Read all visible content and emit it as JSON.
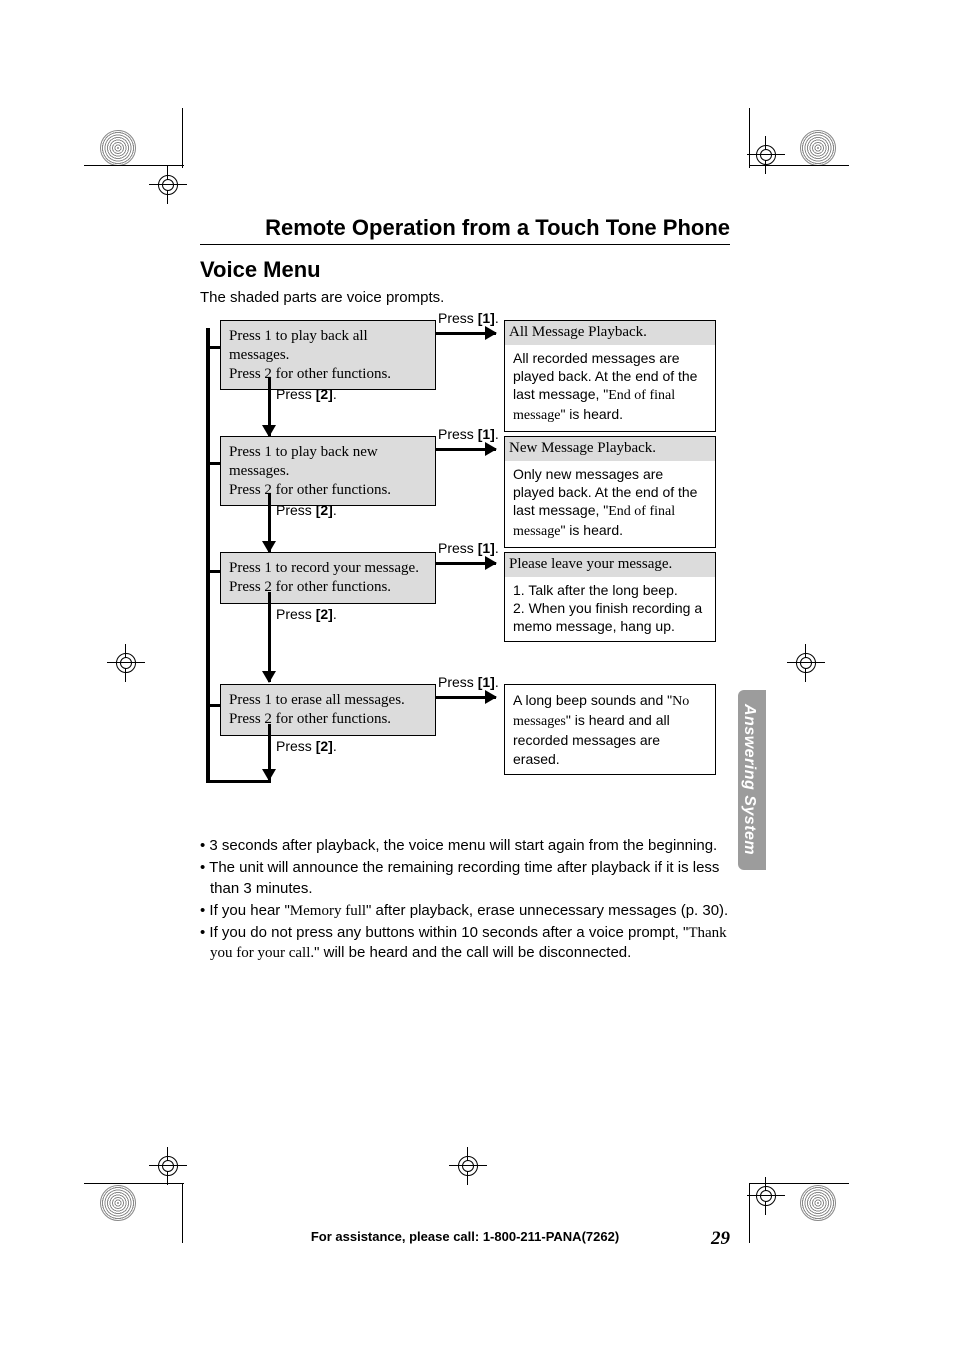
{
  "title": "Remote Operation from a Touch Tone Phone",
  "subtitle": "Voice Menu",
  "intro": "The shaded parts are voice prompts.",
  "side_tab": "Answering System",
  "press1": "Press [1].",
  "press2": "Press [2].",
  "steps": [
    {
      "prompt": "Press 1 to play back all messages.\nPress 2 for other functions.",
      "result_shaded": "All Message Playback.",
      "result_plain_pre": "All recorded messages are played back. At the end of the last message, \"",
      "result_serif": "End of final message",
      "result_plain_post": "\" is heard."
    },
    {
      "prompt": "Press 1 to play back new messages.\nPress 2 for other functions.",
      "result_shaded": "New Message Playback.",
      "result_plain_pre": "Only new messages are played back. At the end of the last message, \"",
      "result_serif": "End of final message",
      "result_plain_post": "\" is heard."
    },
    {
      "prompt": "Press 1 to record your message.\nPress 2 for other functions.",
      "result_shaded": "Please leave your message.",
      "result_list": [
        "Talk after the long beep.",
        "When you finish recording a memo message, hang up."
      ]
    },
    {
      "prompt": "Press 1 to erase all messages.\nPress 2 for other functions.",
      "result_plain_pre": "A long beep sounds and \"",
      "result_serif": "No messages",
      "result_plain_post": "\" is heard and all recorded messages are erased."
    }
  ],
  "bullets": [
    {
      "pre": "3 seconds after playback, the voice menu will start again from the beginning."
    },
    {
      "pre": "The unit will announce the remaining recording time after playback if it is less than 3 minutes."
    },
    {
      "pre": "If you hear \"",
      "serif": "Memory full",
      "post": "\" after playback, erase unnecessary messages (p. 30)."
    },
    {
      "pre": "If you do not press any buttons within 10 seconds after a voice prompt, \"",
      "serif": "Thank you for your call.",
      "post": "\" will be heard and the call will be disconnected."
    }
  ],
  "footer": {
    "assist": "For assistance, please call: 1-800-211-PANA(7262)",
    "page": "29"
  }
}
